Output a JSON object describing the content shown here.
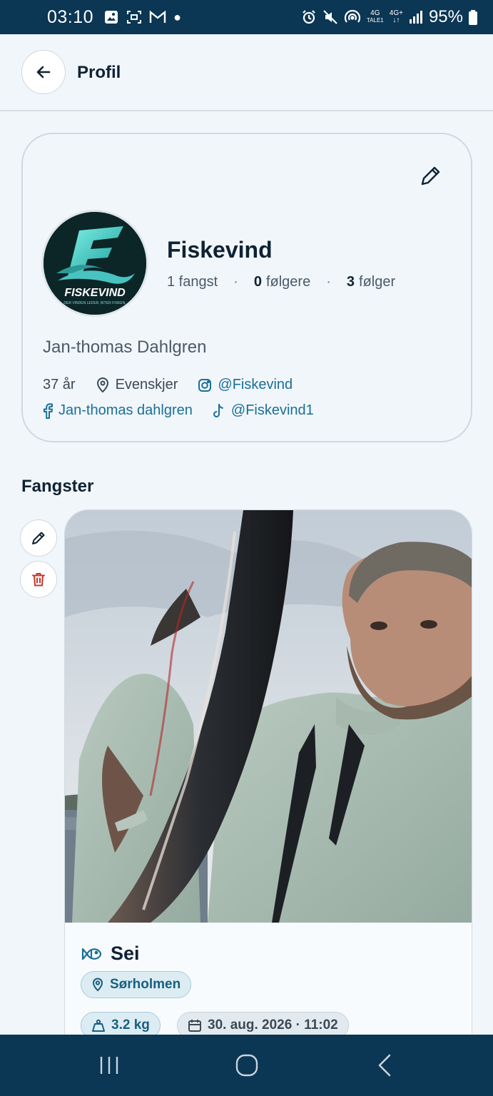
{
  "status_bar": {
    "time": "03:10",
    "network_top": "4G",
    "network_bottom": "TALE1",
    "network2": "4G+",
    "battery": "95%"
  },
  "header": {
    "title": "Profil"
  },
  "profile": {
    "logo_text": "FISKEVIND",
    "logo_tagline": "DER VINDEN LEDER, BITER FISKEN.",
    "name": "Fiskevind",
    "catches_count": "1 fangst",
    "followers_count": "0",
    "followers_label": "følgere",
    "following_count": "3",
    "following_label": "følger",
    "full_name": "Jan-thomas Dahlgren",
    "age": "37 år",
    "location": "Evenskjer",
    "instagram": "@Fiskevind",
    "facebook": "Jan-thomas dahlgren",
    "tiktok": "@Fiskevind1"
  },
  "catches_section": {
    "title": "Fangster"
  },
  "catch": {
    "species": "Sei",
    "location": "Sørholmen",
    "weight": "3.2 kg",
    "datetime": "30. aug. 2026 · 11:02"
  },
  "colors": {
    "status_bar": "#0b3654",
    "background": "#f1f6fa",
    "accent": "#1a6f96",
    "delete": "#c0392b"
  }
}
